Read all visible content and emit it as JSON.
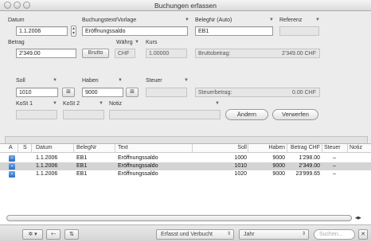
{
  "window": {
    "title": "Buchungen erfassen"
  },
  "form": {
    "datum_label": "Datum",
    "datum_value": "1.1.2006",
    "buchungstext_label": "Buchungstext/Vorlage",
    "buchungstext_value": "Eröffnungssaldo",
    "belegnr_label": "BelegNr (Auto)",
    "belegnr_value": "EB1",
    "referenz_label": "Referenz",
    "referenz_value": "",
    "betrag_label": "Betrag",
    "betrag_value": "2'349.00",
    "brutto_button": "Brutto",
    "waehrung_label": "Währg",
    "waehrung_value": "CHF",
    "kurs_label": "Kurs",
    "kurs_value": "1.00000",
    "bruttobetrag_label": "Bruttobetrag:",
    "bruttobetrag_value": "2'349.00 CHF",
    "soll_label": "Soll",
    "soll_value": "1010",
    "haben_label": "Haben",
    "haben_value": "9000",
    "steuer_label": "Steuer",
    "steuer_value": "",
    "steuerbetrag_label": "Steuerbetrag:",
    "steuerbetrag_value": "0.00 CHF",
    "kost1_label": "KoSt 1",
    "kost2_label": "KoSt 2",
    "notiz_label": "Notiz",
    "aendern_button": "Ändern",
    "verwerfen_button": "Verwerfen"
  },
  "table": {
    "columns": [
      "A",
      "S",
      "Datum",
      "BelegNr",
      "Text",
      "Soll",
      "Haben",
      "Betrag CHF",
      "Steuer",
      "Notiz"
    ],
    "rows": [
      {
        "datum": "1.1.2006",
        "belegnr": "EB1",
        "text": "Eröffnungssaldo",
        "soll": "1000",
        "haben": "9000",
        "betrag": "1'298.00",
        "steuer": "–",
        "selected": false
      },
      {
        "datum": "1.1.2006",
        "belegnr": "EB1",
        "text": "Eröffnungssaldo",
        "soll": "1010",
        "haben": "9000",
        "betrag": "2'349.00",
        "steuer": "–",
        "selected": true
      },
      {
        "datum": "1.1.2006",
        "belegnr": "EB1",
        "text": "Eröffnungssaldo",
        "soll": "1020",
        "haben": "9000",
        "betrag": "23'999.65",
        "steuer": "–",
        "selected": false
      }
    ]
  },
  "bottombar": {
    "mode_popup": "Erfasst und Verbucht",
    "period_popup": "Jahr",
    "search_placeholder": "Suchen..."
  },
  "colors": {
    "selection": "#d4d4d4",
    "row_icon": "#3a78cf"
  },
  "icons": [
    "gear-icon",
    "add-row-icon",
    "sort-icon",
    "clear-search-icon",
    "scroll-left-icon",
    "scroll-right-icon"
  ]
}
